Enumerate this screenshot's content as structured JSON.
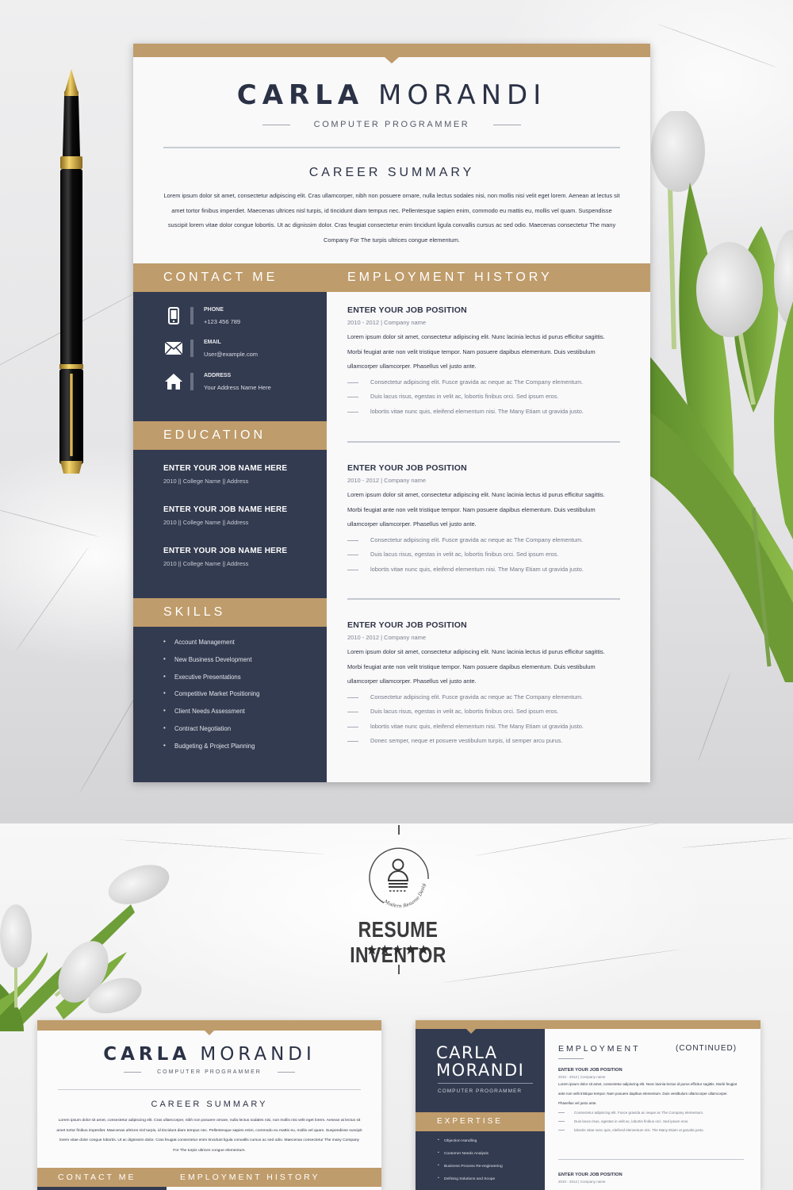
{
  "colors": {
    "gold": "#bf9c6b",
    "navy": "#333b50",
    "ink": "#2b3246"
  },
  "resume": {
    "first_name": "CARLA",
    "last_name": "MORANDI",
    "title": "COMPUTER PROGRAMMER",
    "career_summary": {
      "heading": "CAREER SUMMARY",
      "text": "Lorem ipsum dolor sit amet, consectetur adipiscing elit. Cras ullamcorper, nibh non posuere ornare, nulla lectus sodales nisi, non mollis nisi velit eget lorem. Aenean at lectus sit amet tortor finibus imperdiet. Maecenas ultrices nisl turpis, id tincidunt diam tempus nec. Pellentesque sapien enim, commodo eu mattis eu, mollis vel quam. Suspendisse suscipit lorem vitae dolor congue lobortis. Ut ac dignissim dolor. Cras feugiat consectetur enim tincidunt ligula convallis cursus ac sed odio. Maecenas consectetur The many Company For The turpis ultrices congue elementum."
    },
    "contact": {
      "heading": "CONTACT ME",
      "items": [
        {
          "icon": "phone-icon",
          "label": "PHONE",
          "value": "+123 456 789"
        },
        {
          "icon": "mail-icon",
          "label": "EMAIL",
          "value": "User@example.com"
        },
        {
          "icon": "home-icon",
          "label": "ADDRESS",
          "value": "Your Address Name Here"
        }
      ]
    },
    "education": {
      "heading": "EDUCATION",
      "items": [
        {
          "title": "ENTER YOUR JOB NAME HERE",
          "sub": "2010  ||  College Name ||  Address"
        },
        {
          "title": "ENTER YOUR JOB NAME HERE",
          "sub": "2010  ||  College Name ||  Address"
        },
        {
          "title": "ENTER YOUR JOB NAME HERE",
          "sub": "2010  ||  College Name ||  Address"
        }
      ]
    },
    "skills": {
      "heading": "SKILLS",
      "items": [
        "Account Management",
        "New Business Development",
        "Executive Presentations",
        "Competitive Market Positioning",
        "Client Needs Assessment",
        "Contract Negotiation",
        "Budgeting & Project Planning"
      ]
    },
    "employment": {
      "heading": "EMPLOYMENT HISTORY",
      "jobs": [
        {
          "title": "ENTER YOUR JOB POSITION",
          "meta": "2010 - 2012 | Company name",
          "desc": "Lorem ipsum dolor sit amet, consectetur adipiscing elit. Nunc lacinia lectus id purus efficitur sagittis. Morbi feugiat ante non velit tristique tempor. Nam posuere dapibus elementum. Duis vestibulum ullamcorper ullamcorper. Phasellus vel justo ante.",
          "bullets": [
            "Consectetur adipiscing elit. Fusce gravida ac neque ac The  Company elementum.",
            "Duis lacus risus, egestas in velit ac, lobortis finibus orci. Sed ipsum eros.",
            "lobortis vitae nunc quis, eleifend elementum nisi. The Many Etiam ut gravida justo."
          ]
        },
        {
          "title": "ENTER YOUR JOB POSITION",
          "meta": "2010 - 2012 | Company name",
          "desc": "Lorem ipsum dolor sit amet, consectetur adipiscing elit. Nunc lacinia lectus id purus efficitur sagittis. Morbi feugiat ante non velit tristique tempor. Nam posuere dapibus elementum. Duis vestibulum ullamcorper ullamcorper. Phasellus vel justo ante.",
          "bullets": [
            "Consectetur adipiscing elit. Fusce gravida ac neque ac The  Company elementum.",
            "Duis lacus risus, egestas in velit ac, lobortis finibus orci. Sed ipsum eros.",
            "lobortis vitae nunc quis, eleifend elementum nisi. The Many Etiam ut gravida justo."
          ]
        },
        {
          "title": "ENTER YOUR JOB POSITION",
          "meta": "2010 - 2012 | Company name",
          "desc": "Lorem ipsum dolor sit amet, consectetur adipiscing elit. Nunc lacinia lectus id purus efficitur sagittis. Morbi feugiat ante non velit tristique tempor. Nam posuere dapibus elementum. Duis vestibulum ullamcorper ullamcorper. Phasellus vel justo ante.",
          "bullets": [
            "Consectetur adipiscing elit. Fusce gravida ac neque ac The  Company elementum.",
            "Duis lacus risus, egestas in velit ac, lobortis finibus orci. Sed ipsum eros.",
            "lobortis vitae nunc quis, eleifend elementum nisi. The Many Etiam ut gravida justo.",
            "Donec semper, neque et posuere vestibulum turpis, id semper arcu purus."
          ]
        }
      ]
    }
  },
  "brand": {
    "name": "RESUME INVENTOR",
    "tagline": "Modern Resume Design",
    "stars": "★★★★★",
    "rating": 5
  },
  "thumb2": {
    "first_name": "CARLA",
    "last_name": "MORANDI",
    "title": "COMPUTER PROGRAMMER",
    "expertise_heading": "EXPERTISE",
    "expertise": [
      "Objection Handling",
      "Customer Needs Analysis",
      "Business Process Re-engineering",
      "Defining Solutions and Scope"
    ],
    "employment_heading": "EMPLOYMENT",
    "continued": "(CONTINUED)",
    "job_title": "ENTER YOUR JOB POSITION",
    "job_meta": "2010 - 2012 | Company name",
    "job_desc": "Lorem ipsum dolor sit amet, consectetur adipiscing elit. Nunc lacinia lectus id purus efficitur sagittis. Morbi feugiat ante non velit tristique tempor. Nam posuere dapibus elementum. Duis vestibulum ullamcorper ullamcorper. Phasellus vel justo ante.",
    "job_bullets": [
      "Consectetur adipiscing elit. Fusce gravida ac neque ac The  Company elementum.",
      "Duis lacus risus, egestas in velit ac, lobortis finibus orci. Sed ipsum eros.",
      "lobortis vitae nunc quis, eleifend elementum nisi. The Many Etiam ut gravida justo."
    ]
  }
}
